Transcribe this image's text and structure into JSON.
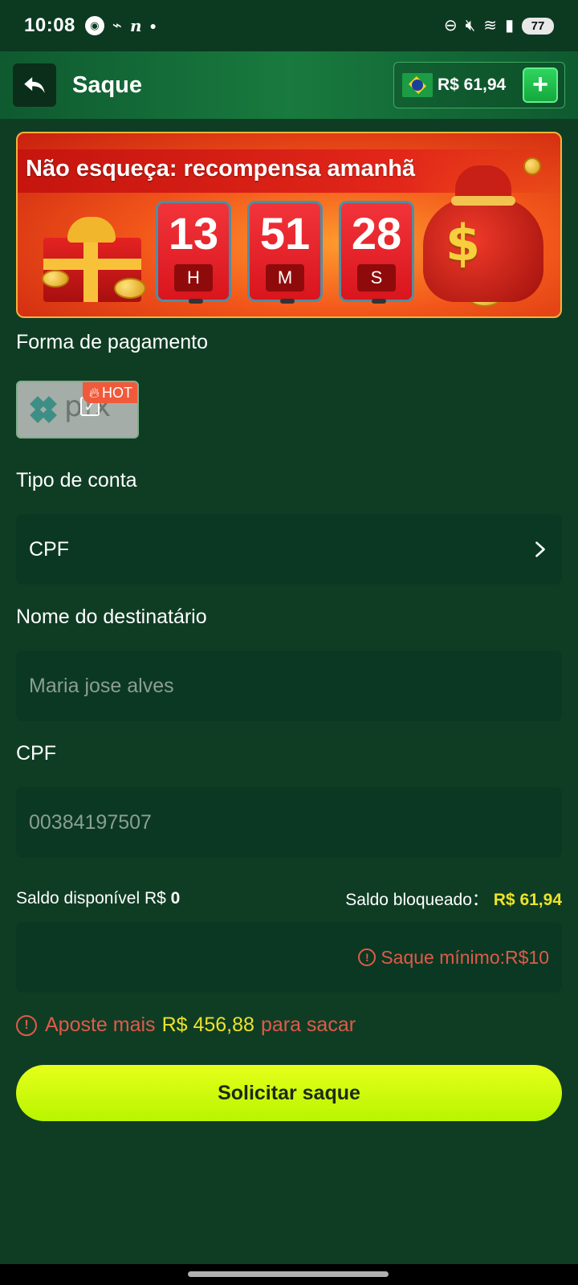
{
  "status_bar": {
    "time": "10:08",
    "battery": "77"
  },
  "header": {
    "title": "Saque",
    "balance": "R$ 61,94",
    "add_label": "+"
  },
  "banner": {
    "title": "Não esqueça: recompensa amanhã",
    "timer": [
      {
        "value": "13",
        "unit": "H"
      },
      {
        "value": "51",
        "unit": "M"
      },
      {
        "value": "28",
        "unit": "S"
      }
    ]
  },
  "payment": {
    "label": "Forma de pagamento",
    "method_name": "pix",
    "hot_badge": "HOT"
  },
  "account_type": {
    "label": "Tipo de conta",
    "value": "CPF"
  },
  "recipient": {
    "label": "Nome do destinatário",
    "placeholder": "Maria jose alves"
  },
  "cpf": {
    "label": "CPF",
    "placeholder": "00384197507"
  },
  "saldo": {
    "available_label": "Saldo disponível R$",
    "available_value": "0",
    "blocked_label": "Saldo bloqueado：",
    "blocked_value": "R$ 61,94"
  },
  "amount": {
    "min_text": "Saque mínimo:R$10"
  },
  "bet_notice": {
    "prefix": "Aposte mais",
    "amount": "R$ 456,88",
    "suffix": "para sacar"
  },
  "submit": {
    "label": "Solicitar saque"
  },
  "colors": {
    "background": "#0f3d24",
    "field": "#0b3822",
    "accent_yellow": "#ece32a",
    "warning": "#e05a4a",
    "button": "#d4ff0a"
  }
}
